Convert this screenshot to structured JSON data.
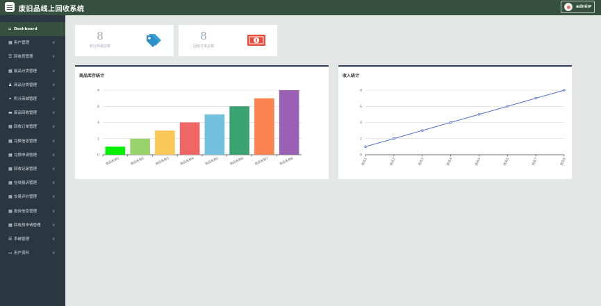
{
  "header": {
    "title": "废旧品线上回收系统",
    "user": "admin",
    "user_caret": "▾"
  },
  "sidebar": {
    "items": [
      {
        "label": "Dashboard",
        "icon": "home-icon",
        "glyph": "⌂",
        "active": true,
        "chevron": ""
      },
      {
        "label": "用户管理",
        "icon": "grid-icon",
        "glyph": "▦",
        "chevron": "∨"
      },
      {
        "label": "回收员管理",
        "icon": "list-icon",
        "glyph": "☰",
        "chevron": "∨"
      },
      {
        "label": "废品分类管理",
        "icon": "grid-icon",
        "glyph": "▦",
        "chevron": "∨"
      },
      {
        "label": "商品分类管理",
        "icon": "user-icon",
        "glyph": "♟",
        "chevron": "∨"
      },
      {
        "label": "积分商城管理",
        "icon": "link-icon",
        "glyph": "⚭",
        "chevron": "∨"
      },
      {
        "label": "废品回收管理",
        "icon": "monitor-icon",
        "glyph": "▬",
        "chevron": "∨"
      },
      {
        "label": "回收订单管理",
        "icon": "grid-icon",
        "glyph": "▦",
        "chevron": "∨"
      },
      {
        "label": "兑换信息管理",
        "icon": "grid-icon",
        "glyph": "▦",
        "chevron": "∨"
      },
      {
        "label": "兑换申请管理",
        "icon": "grid-icon",
        "glyph": "▦",
        "chevron": "∨"
      },
      {
        "label": "回收记录管理",
        "icon": "grid-icon",
        "glyph": "▦",
        "chevron": "∨"
      },
      {
        "label": "在线投诉管理",
        "icon": "grid-icon",
        "glyph": "▦",
        "chevron": "∨"
      },
      {
        "label": "交易评价管理",
        "icon": "grid-icon",
        "glyph": "▦",
        "chevron": "∨"
      },
      {
        "label": "投诉信息管理",
        "icon": "grid-icon",
        "glyph": "▦",
        "chevron": "∨"
      },
      {
        "label": "回收员申请管理",
        "icon": "grid-icon",
        "glyph": "▦",
        "chevron": "∨"
      },
      {
        "label": "系统管理",
        "icon": "list-icon",
        "glyph": "☰",
        "chevron": "∨"
      },
      {
        "label": "用户资料",
        "icon": "card-icon",
        "glyph": "▭",
        "chevron": "∨"
      }
    ]
  },
  "stats": [
    {
      "value": "8",
      "label": "积分商城总数",
      "icon": "tag-icon",
      "color": "#3aa0d8"
    },
    {
      "value": "8",
      "label": "回收订单总数",
      "icon": "money-icon",
      "color": "#e74c3c"
    }
  ],
  "chart_data": [
    {
      "type": "bar",
      "title": "商品库存统计",
      "categories": [
        "商品名称1",
        "商品名称2",
        "商品名称3",
        "商品名称4",
        "商品名称5",
        "商品名称6",
        "商品名称7",
        "商品名称8"
      ],
      "values": [
        1,
        2,
        3,
        4,
        5,
        6,
        7,
        8
      ],
      "colors": [
        "#00ee00",
        "#99d36b",
        "#fac858",
        "#ee6666",
        "#73c0de",
        "#3ba272",
        "#fc8452",
        "#9a60b4"
      ],
      "ylim": [
        0,
        8
      ],
      "yticks": [
        0,
        2,
        4,
        6,
        8
      ],
      "grid": true,
      "xlabel": "",
      "ylabel": ""
    },
    {
      "type": "line",
      "title": "收入统计",
      "categories": [
        "姓名1",
        "姓名2",
        "姓名3",
        "姓名4",
        "姓名5",
        "姓名6",
        "姓名7",
        "姓名8"
      ],
      "series": [
        {
          "values": [
            1,
            2,
            3,
            4,
            5,
            6,
            7,
            8
          ],
          "color": "#5470c6"
        }
      ],
      "ylim": [
        0,
        8
      ],
      "yticks": [
        0,
        2,
        4,
        6,
        8
      ],
      "grid": true,
      "xlabel": "",
      "ylabel": ""
    }
  ]
}
